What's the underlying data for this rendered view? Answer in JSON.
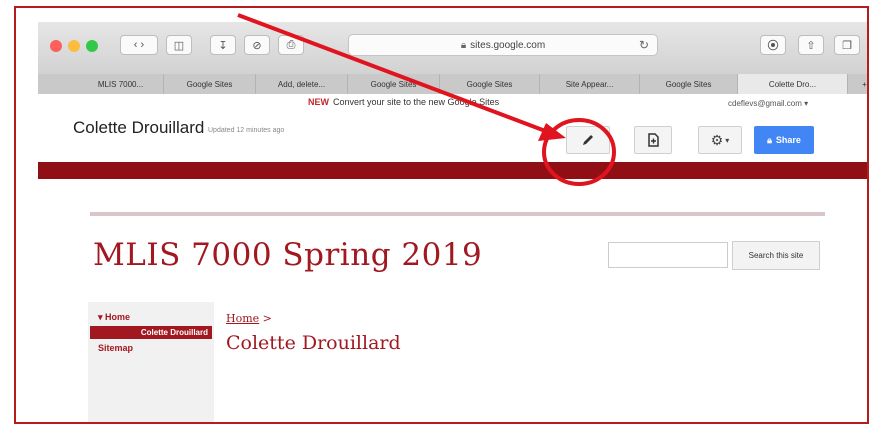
{
  "browser": {
    "url": "sites.google.com",
    "tabs": [
      {
        "label": "MLIS 7000..."
      },
      {
        "label": "Google Sites"
      },
      {
        "label": "Add, delete..."
      },
      {
        "label": "Google Sites"
      },
      {
        "label": "Google Sites"
      },
      {
        "label": "Site Appear..."
      },
      {
        "label": "Google Sites"
      },
      {
        "label": "Colette Dro..."
      }
    ]
  },
  "sites_bar": {
    "new_tag": "NEW",
    "banner": "Convert your site to the new Google Sites",
    "site_owner": "Colette Drouillard",
    "updated": "Updated 12 minutes ago",
    "account": "cdeflevs@gmail.com",
    "share_label": "Share"
  },
  "page": {
    "title": "MLIS 7000 Spring 2019",
    "search_button": "Search this site",
    "breadcrumb_home": "Home",
    "breadcrumb_sep": ">",
    "content_title": "Colette Drouillard"
  },
  "sidebar": {
    "home": "Home",
    "active": "Colette Drouillard",
    "sitemap": "Sitemap"
  },
  "colors": {
    "accent": "#a11820",
    "share": "#4285f4",
    "annotation": "#e0141e"
  }
}
